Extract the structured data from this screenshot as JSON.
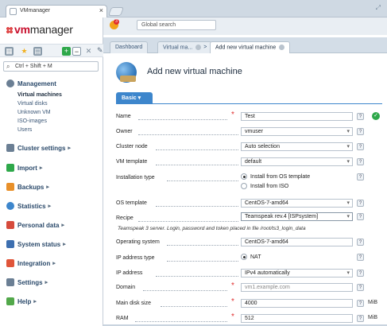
{
  "browser": {
    "tab_title": "VMmanager",
    "close_glyph": "×",
    "restore_glyph": "⤢"
  },
  "sidebar": {
    "logo_prefix": "vm",
    "logo_suffix": "manager",
    "hotkey_text": "Ctrl + Shift + M",
    "toolbar_icons": [
      "list-icon",
      "star-icon",
      "briefcase-icon",
      "expand-icon",
      "collapse-icon"
    ],
    "management_label": "Management",
    "management_items": [
      "Virtual machines",
      "Virtual disks",
      "Unknown VM",
      "ISO-images",
      "Users"
    ],
    "sections": [
      "Cluster settings",
      "Import",
      "Backups",
      "Statistics",
      "Personal data",
      "System status",
      "Integration",
      "Settings",
      "Help"
    ],
    "section_colors": [
      "#6b7f94",
      "#2ea84a",
      "#e8902a",
      "#3d86cc",
      "#d64b3c",
      "#3d6fb0",
      "#e0553a",
      "#6b7f94",
      "#52a84a"
    ]
  },
  "topbar": {
    "alert_count": "3",
    "search_placeholder": "Global search"
  },
  "tabs": {
    "items": [
      "Dashboard",
      "Virtual ma...",
      "Add new virtual machine"
    ],
    "separator": ">"
  },
  "page": {
    "title": "Add new virtual machine",
    "form_tab": "Basic"
  },
  "form": {
    "name_label": "Name",
    "name_value": "Test",
    "owner_label": "Owner",
    "owner_value": "vmuser",
    "cluster_node_label": "Cluster node",
    "cluster_node_value": "Auto selection",
    "vm_template_label": "VM template",
    "vm_template_value": "default",
    "installation_type_label": "Installation type",
    "install_os_template": "Install from OS template",
    "install_iso": "Install from ISO",
    "os_template_label": "OS template",
    "os_template_value": "CentOS-7-amd64",
    "recipe_label": "Recipe",
    "recipe_value": "Teamspeak rev.4 [ISPsystem]",
    "recipe_note": "Teamspeak 3 server. Login, password and token placed in file /root/ts3_login_data",
    "operating_system_label": "Operating system",
    "operating_system_value": "CentOS-7-amd64",
    "ip_type_label": "IP address type",
    "ip_type_value": "NAT",
    "ip_address_label": "IP address",
    "ip_address_value": "IPv4 automatically",
    "domain_label": "Domain",
    "domain_placeholder": "vm1.example.com",
    "disk_label": "Main disk size",
    "disk_value": "4000",
    "disk_unit": "MiB",
    "ram_label": "RAM",
    "ram_value": "512",
    "ram_unit": "MiB",
    "help_glyph": "?",
    "required_glyph": "*",
    "ok_glyph": "✓",
    "dropdown_glyph": "▾"
  }
}
